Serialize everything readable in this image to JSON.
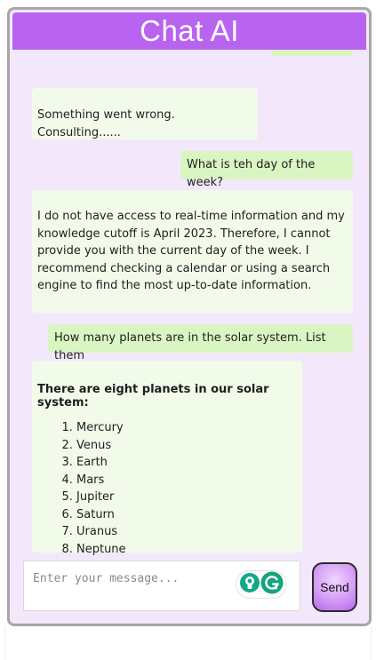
{
  "header": {
    "title": "Chat AI"
  },
  "messages": [
    {
      "role": "bot",
      "text": "Something went wrong. Consulting......"
    },
    {
      "role": "user",
      "text": "What is teh day of the week?"
    },
    {
      "role": "bot",
      "text": "I do not have access to real-time information and my knowledge cutoff is April 2023. Therefore, I cannot provide you with the current day of the week. I recommend checking a calendar or using a search engine to find the most up-to-date information."
    },
    {
      "role": "user",
      "text": "How many planets are in the solar system. List them"
    },
    {
      "role": "bot",
      "title": "There are eight planets in our solar system:",
      "items": [
        "Mercury",
        "Venus",
        "Earth",
        "Mars",
        "Jupiter",
        "Saturn",
        "Uranus",
        "Neptune"
      ]
    }
  ],
  "composer": {
    "placeholder": "Enter your message...",
    "value": ""
  },
  "send_button": {
    "label": "Send"
  },
  "icons": {
    "header": "none",
    "grammar_suggestion": "lightbulb-icon",
    "grammar_logo": "g-logo-icon"
  },
  "colors": {
    "header": "#b864f0",
    "background": "#f3e8fb",
    "bot_bubble": "#f2fbea",
    "user_bubble": "#d9f5c2",
    "send_button": "#d49cf5"
  }
}
